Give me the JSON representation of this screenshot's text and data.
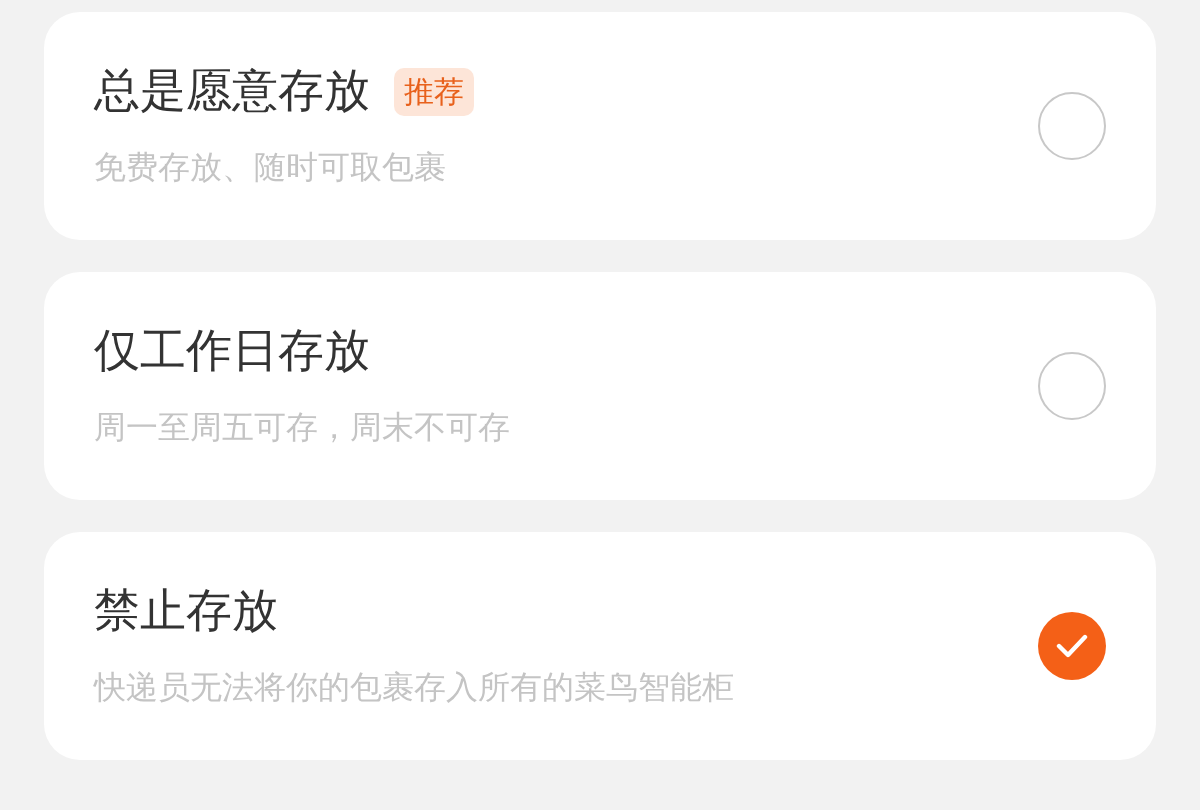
{
  "options": [
    {
      "title": "总是愿意存放",
      "badge": "推荐",
      "description": "免费存放、随时可取包裹",
      "selected": false
    },
    {
      "title": "仅工作日存放",
      "description": "周一至周五可存，周末不可存",
      "selected": false
    },
    {
      "title": "禁止存放",
      "description": "快递员无法将你的包裹存入所有的菜鸟智能柜",
      "selected": true
    }
  ]
}
